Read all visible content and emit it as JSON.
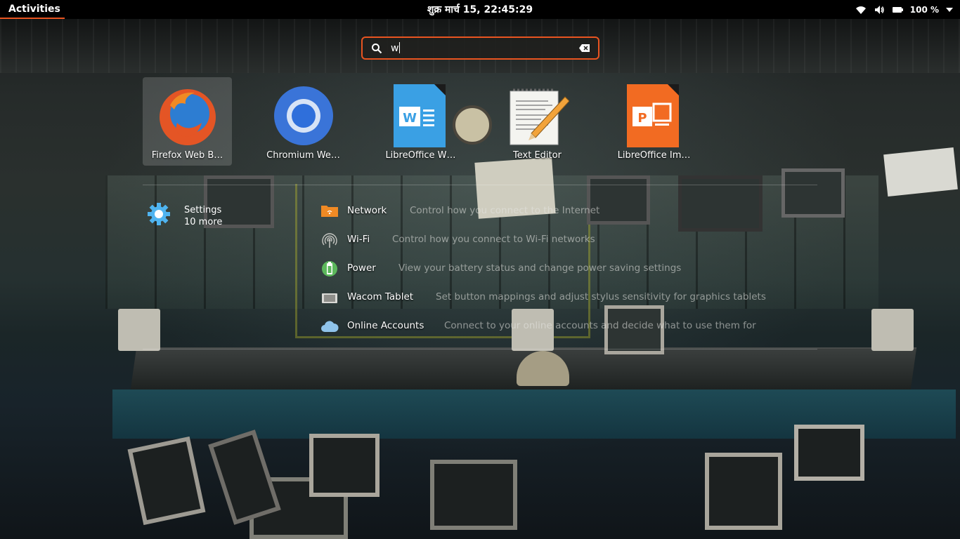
{
  "topbar": {
    "activities": "Activities",
    "clock": "शुक्र मार्च 15, 22:45:29",
    "battery": "100 %",
    "accent": "#e95420"
  },
  "search": {
    "value": "w",
    "icon": "search-icon",
    "clear_icon": "clear-icon"
  },
  "apps": [
    {
      "label": "Firefox Web B…",
      "icon": "firefox-icon",
      "selected": true
    },
    {
      "label": "Chromium We…",
      "icon": "chromium-icon"
    },
    {
      "label": "LibreOffice W…",
      "icon": "libreoffice-writer-icon"
    },
    {
      "label": "Text Editor",
      "icon": "text-editor-icon"
    },
    {
      "label": "LibreOffice Im…",
      "icon": "libreoffice-impress-icon"
    }
  ],
  "provider": {
    "name": "Settings",
    "more": "10 more",
    "icon": "settings-gear-icon"
  },
  "results": [
    {
      "title": "Network",
      "description": "Control how you connect to the Internet",
      "icon": "network-icon"
    },
    {
      "title": "Wi-Fi",
      "description": "Control how you connect to Wi-Fi networks",
      "icon": "wifi-icon"
    },
    {
      "title": "Power",
      "description": "View your battery status and change power saving settings",
      "icon": "power-icon"
    },
    {
      "title": "Wacom Tablet",
      "description": "Set button mappings and adjust stylus sensitivity for graphics tablets",
      "icon": "wacom-tablet-icon"
    },
    {
      "title": "Online Accounts",
      "description": "Connect to your online accounts and decide what to use them for",
      "icon": "online-accounts-icon"
    }
  ]
}
